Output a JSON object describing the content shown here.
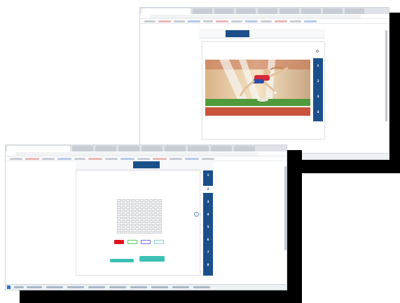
{
  "screen_top": {
    "step_labels": [
      "",
      "",
      "",
      "",
      ""
    ],
    "question": "",
    "sidebar_numbers": [
      "1",
      "2",
      "3",
      "4"
    ],
    "caption": "",
    "next_label": "",
    "clock": ""
  },
  "screen_bottom": {
    "step_labels": [
      "",
      "",
      "",
      "",
      ""
    ],
    "title": "",
    "subtitle": "",
    "sidebar_numbers": [
      "1",
      "2",
      "3",
      "4",
      "5",
      "6",
      "7",
      "8"
    ],
    "button_left": "",
    "button_right": "",
    "caption": "",
    "next_label": "",
    "clock": ""
  },
  "colors": {
    "nav_blue": "#1b4f8a",
    "teal_button": "#3cc0b4",
    "swatch_red": "#e0141c",
    "swatch_green_outline": "#5ccb6a",
    "swatch_purple_outline": "#7a6de0",
    "swatch_teal_outline": "#7fd6cf",
    "track_red": "#c9533c",
    "grass_green": "#4f9a3a"
  },
  "icons": [
    "chrome-tab-icon",
    "info-icon",
    "windows-start-icon"
  ]
}
